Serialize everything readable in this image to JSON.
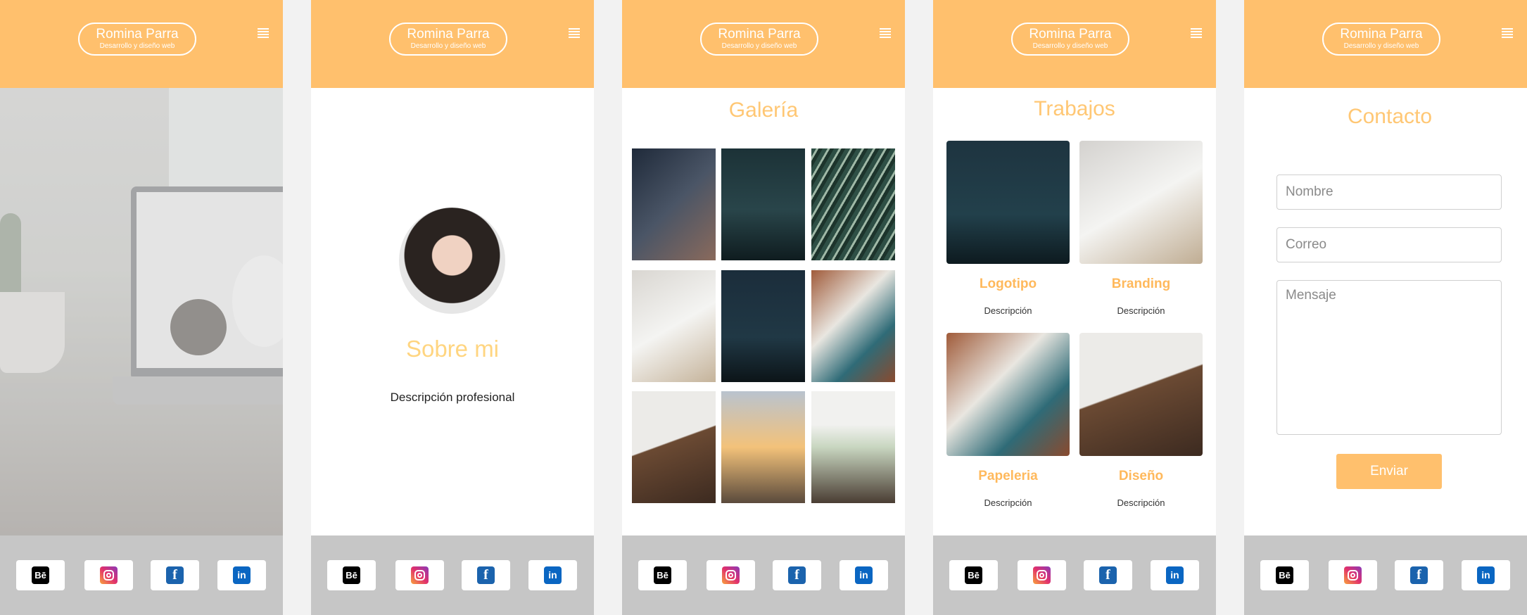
{
  "brand": {
    "name": "Romina Parra",
    "subtitle": "Desarrollo y diseño web"
  },
  "colors": {
    "header": "#ffc06d",
    "footer": "#c6c6c6",
    "accent_title": "#ffc774",
    "button": "#ffc06d"
  },
  "social": [
    {
      "icon": "behance-icon",
      "glyph": "Bē"
    },
    {
      "icon": "instagram-icon",
      "glyph": ""
    },
    {
      "icon": "facebook-icon",
      "glyph": "f"
    },
    {
      "icon": "linkedin-icon",
      "glyph": "in"
    }
  ],
  "about": {
    "title": "Sobre mi",
    "description": "Descripción profesional"
  },
  "gallery": {
    "title": "Galería"
  },
  "works": {
    "title": "Trabajos",
    "items": [
      {
        "title": "Logotipo",
        "description": "Descripción"
      },
      {
        "title": "Branding",
        "description": "Descripción"
      },
      {
        "title": "Papeleria",
        "description": "Descripción"
      },
      {
        "title": "Diseño",
        "description": "Descripción"
      }
    ]
  },
  "contact": {
    "title": "Contacto",
    "name_placeholder": "Nombre",
    "email_placeholder": "Correo",
    "message_placeholder": "Mensaje",
    "send_label": "Enviar"
  }
}
